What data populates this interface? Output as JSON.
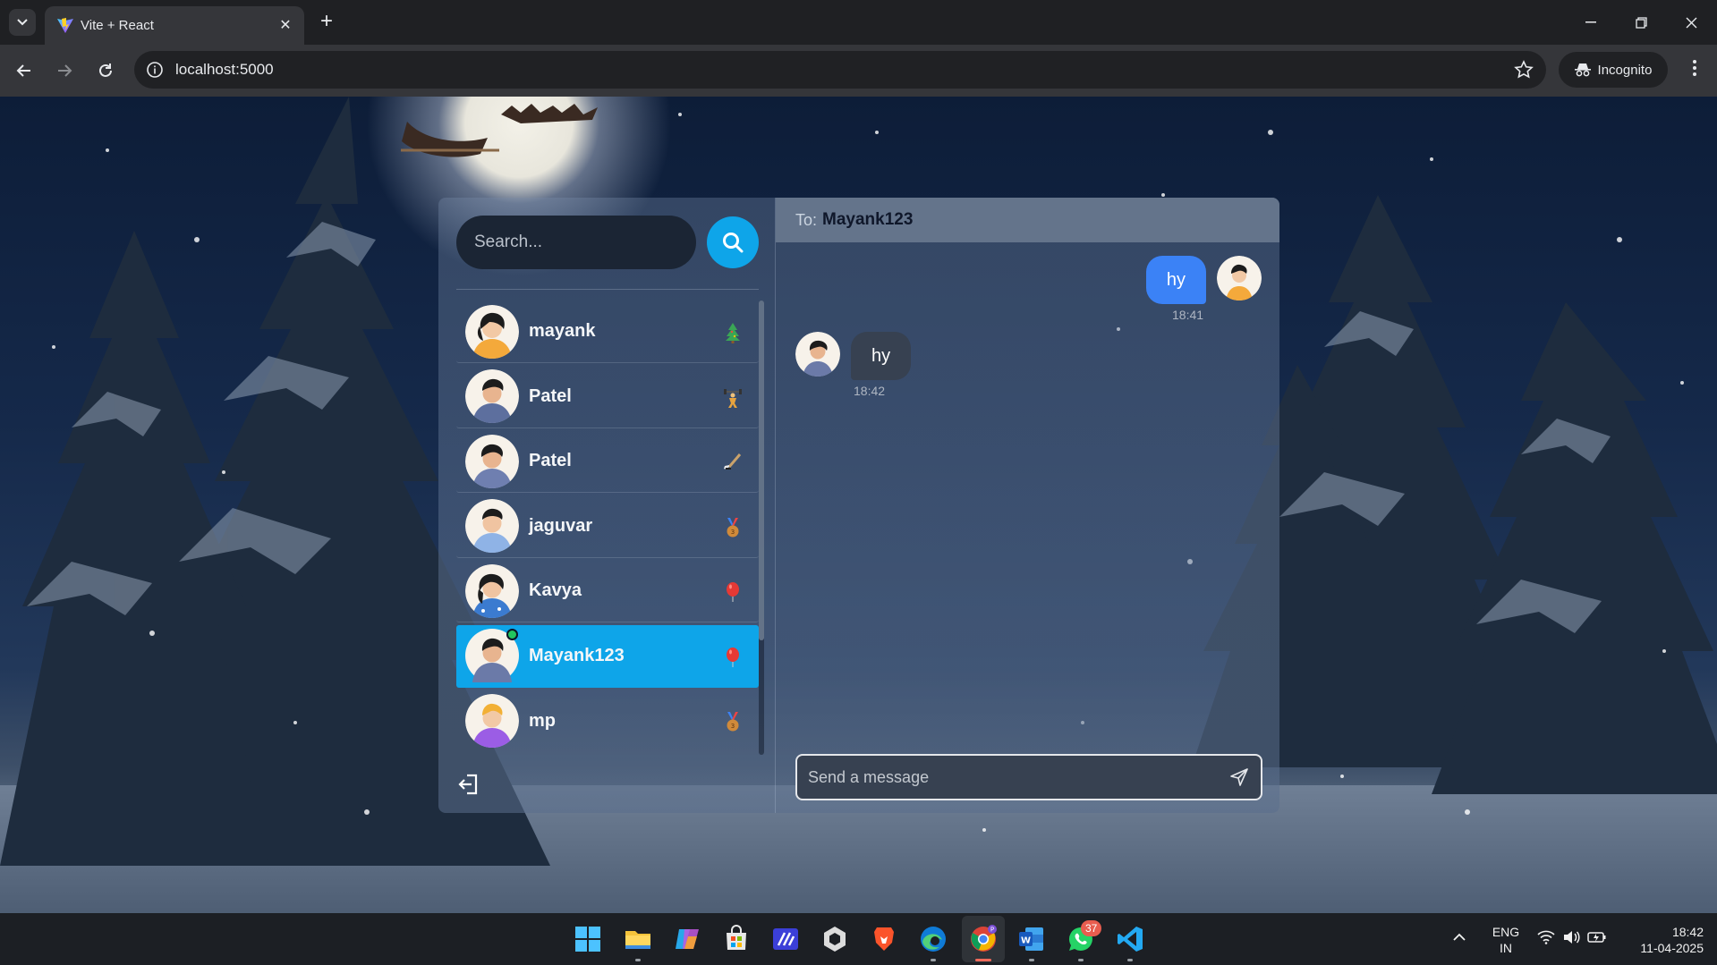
{
  "browser": {
    "tab_title": "Vite + React",
    "url": "localhost:5000",
    "incognito_label": "Incognito"
  },
  "app": {
    "search_placeholder": "Search...",
    "contacts": [
      {
        "name": "mayank",
        "emoji": "tree-emoji",
        "active": false,
        "online": false
      },
      {
        "name": "Patel",
        "emoji": "weightlifter-emoji",
        "active": false,
        "online": false
      },
      {
        "name": "Patel",
        "emoji": "hockey-emoji",
        "active": false,
        "online": false
      },
      {
        "name": "jaguvar",
        "emoji": "bronze-medal-emoji",
        "active": false,
        "online": false
      },
      {
        "name": "Kavya",
        "emoji": "balloon-emoji",
        "active": false,
        "online": false
      },
      {
        "name": "Mayank123",
        "emoji": "balloon-emoji",
        "active": true,
        "online": true
      },
      {
        "name": "mp",
        "emoji": "bronze-medal-emoji",
        "active": false,
        "online": false
      }
    ],
    "chat": {
      "to_label": "To:",
      "to_name": "Mayank123",
      "messages": [
        {
          "from": "me",
          "text": "hy",
          "time": "18:41"
        },
        {
          "from": "them",
          "text": "hy",
          "time": "18:42"
        }
      ],
      "composer_placeholder": "Send a message"
    },
    "colors": {
      "accent": "#0ea5e9",
      "my_bubble": "#3b82f6",
      "their_bubble": "#374151",
      "header": "#64748b"
    }
  },
  "taskbar": {
    "whatsapp_badge": "37",
    "lang_line1": "ENG",
    "lang_line2": "IN",
    "time": "18:42",
    "date": "11-04-2025"
  }
}
